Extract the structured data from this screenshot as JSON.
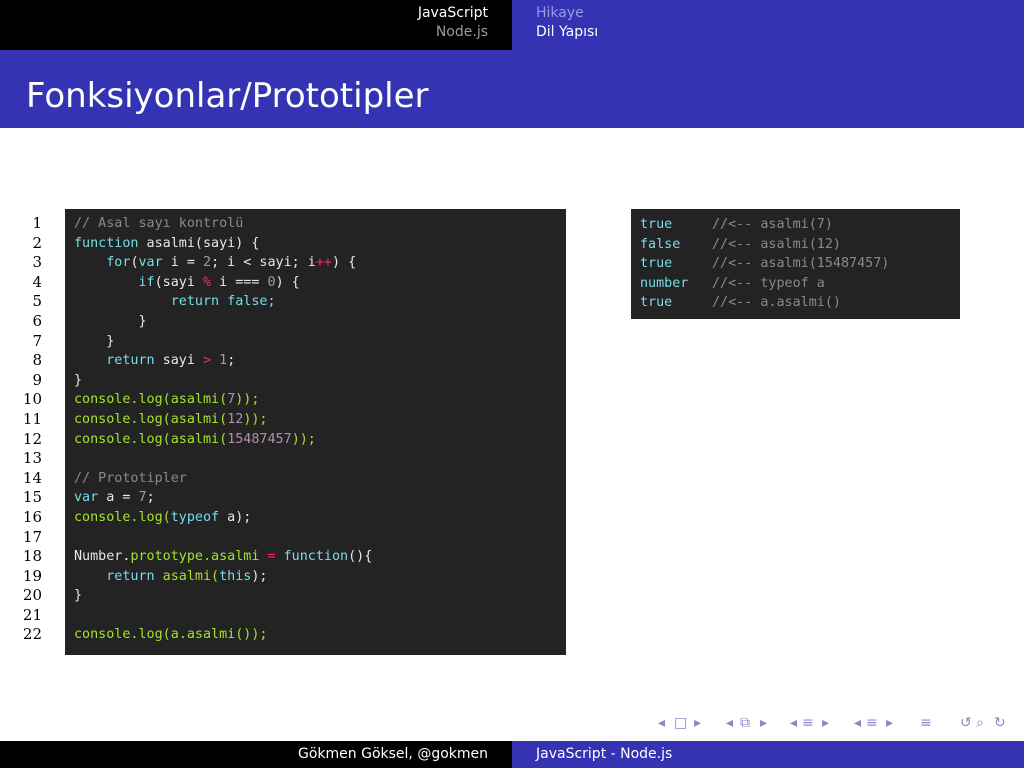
{
  "nav": {
    "left": [
      "JavaScript",
      "Node.js"
    ],
    "right": [
      "Hikaye",
      "Dil Yapısı"
    ]
  },
  "title": "Fonksiyonlar/Prototipler",
  "code": {
    "line_numbers": [
      "1",
      "2",
      "3",
      "4",
      "5",
      "6",
      "7",
      "8",
      "9",
      "10",
      "11",
      "12",
      "13",
      "14",
      "15",
      "16",
      "17",
      "18",
      "19",
      "20",
      "21",
      "22"
    ],
    "lines": [
      [
        [
          "// Asal sayı kontrolü",
          "comment"
        ]
      ],
      [
        [
          "function",
          "kw"
        ],
        [
          " asalmi(sayi) {",
          "plain"
        ]
      ],
      [
        [
          "    ",
          "plain"
        ],
        [
          "for",
          "kw"
        ],
        [
          "(",
          "plain"
        ],
        [
          "var",
          "kw"
        ],
        [
          " i = ",
          "plain"
        ],
        [
          "2",
          "num"
        ],
        [
          "; i < sayi; i",
          "plain"
        ],
        [
          "++",
          "op"
        ],
        [
          ") {",
          "plain"
        ]
      ],
      [
        [
          "        ",
          "plain"
        ],
        [
          "if",
          "kw"
        ],
        [
          "(sayi ",
          "plain"
        ],
        [
          "%",
          "op"
        ],
        [
          " i === ",
          "plain"
        ],
        [
          "0",
          "num"
        ],
        [
          ") {",
          "plain"
        ]
      ],
      [
        [
          "            ",
          "plain"
        ],
        [
          "return",
          "kw"
        ],
        [
          " false;",
          "kw"
        ]
      ],
      [
        [
          "        }",
          "plain"
        ]
      ],
      [
        [
          "    }",
          "plain"
        ]
      ],
      [
        [
          "    ",
          "plain"
        ],
        [
          "return",
          "kw"
        ],
        [
          " sayi ",
          "plain"
        ],
        [
          ">",
          "op"
        ],
        [
          " ",
          "plain"
        ],
        [
          "1",
          "num"
        ],
        [
          ";",
          "plain"
        ]
      ],
      [
        [
          "}",
          "plain"
        ]
      ],
      [
        [
          "console.log(asalmi(",
          "fn"
        ],
        [
          "7",
          "num"
        ],
        [
          "));",
          "fn"
        ]
      ],
      [
        [
          "console.log(asalmi(",
          "fn"
        ],
        [
          "12",
          "num"
        ],
        [
          "));",
          "fn"
        ]
      ],
      [
        [
          "console.log(asalmi(",
          "fn"
        ],
        [
          "15487457",
          "num"
        ],
        [
          "));",
          "fn"
        ]
      ],
      [
        [
          "",
          "plain"
        ]
      ],
      [
        [
          "// Prototipler",
          "comment"
        ]
      ],
      [
        [
          "var",
          "kw"
        ],
        [
          " a = ",
          "plain"
        ],
        [
          "7",
          "num"
        ],
        [
          ";",
          "plain"
        ]
      ],
      [
        [
          "console.log(",
          "fn"
        ],
        [
          "typeof",
          "kw"
        ],
        [
          " a);",
          "plain"
        ]
      ],
      [
        [
          "",
          "plain"
        ]
      ],
      [
        [
          "Number.",
          "plain"
        ],
        [
          "prototype",
          "fn"
        ],
        [
          ".asalmi ",
          "fn"
        ],
        [
          "=",
          "op"
        ],
        [
          " ",
          "plain"
        ],
        [
          "function",
          "kw"
        ],
        [
          "(){",
          "plain"
        ]
      ],
      [
        [
          "    ",
          "plain"
        ],
        [
          "return",
          "kw"
        ],
        [
          " asalmi(",
          "fn"
        ],
        [
          "this",
          "kw"
        ],
        [
          ");",
          "plain"
        ]
      ],
      [
        [
          "}",
          "plain"
        ]
      ],
      [
        [
          "",
          "plain"
        ]
      ],
      [
        [
          "console.log(a.asalmi());",
          "fn"
        ]
      ]
    ]
  },
  "output": [
    {
      "value": "true",
      "comment": "//<-- asalmi(7)"
    },
    {
      "value": "false",
      "comment": "//<-- asalmi(12)"
    },
    {
      "value": "true",
      "comment": "//<-- asalmi(15487457)"
    },
    {
      "value": "number",
      "comment": "//<-- typeof a"
    },
    {
      "value": "true",
      "comment": "//<-- a.asalmi()"
    }
  ],
  "footer": {
    "left": "Gökmen Göksel, @gokmen",
    "right": "JavaScript - Node.js"
  },
  "nav_symbols": [
    "◂",
    "□",
    "▸",
    "◂",
    "⧉",
    "▸",
    "◂",
    "≡",
    "▸",
    "◂",
    "≡",
    "▸",
    "≡",
    "↺",
    "⌕",
    "↻"
  ],
  "colors": {
    "theme_blue": "#3333b3",
    "code_bg": "#232323",
    "keyword": "#78dce8",
    "number": "#b48ead",
    "operator": "#f92672",
    "function": "#a6e22e",
    "comment": "#8a8a8a"
  }
}
